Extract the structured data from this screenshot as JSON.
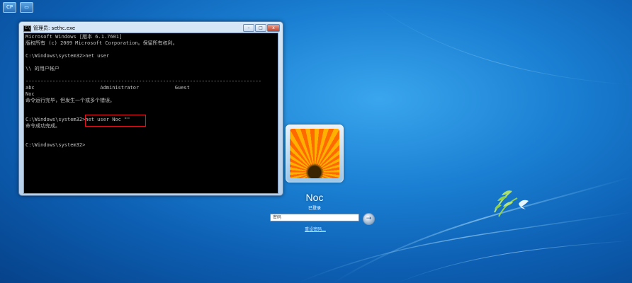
{
  "corner_buttons": [
    "CP",
    ""
  ],
  "console": {
    "title": "管理员: sethc.exe",
    "icon_label": "C:\\",
    "controls": {
      "minimize": "–",
      "maximize": "□",
      "close": "x"
    },
    "lines": [
      "Microsoft Windows [版本 6.1.7601]",
      "版权所有 (c) 2009 Microsoft Corporation。保留所有权利。",
      "",
      "C:\\Windows\\system32>net user",
      "",
      "\\\\ 的用户帐户",
      "",
      "-------------------------------------------------------------------------------",
      "abc                      Administrator            Guest",
      "Noc",
      "命令运行完毕，但发生一个或多个错误。",
      "",
      "",
      "C:\\Windows\\system32>net user Noc \"\"",
      "命令成功完成。",
      "",
      "",
      "C:\\Windows\\system32>"
    ]
  },
  "login": {
    "user_name": "Noc",
    "status": "已登录",
    "password_placeholder": "密码",
    "submit_icon": "→",
    "reset_link": "重设密码..."
  },
  "colors": {
    "background": "#0d5fb3",
    "highlight_box": "#e0141e",
    "logo_green": "#8fd14f"
  }
}
